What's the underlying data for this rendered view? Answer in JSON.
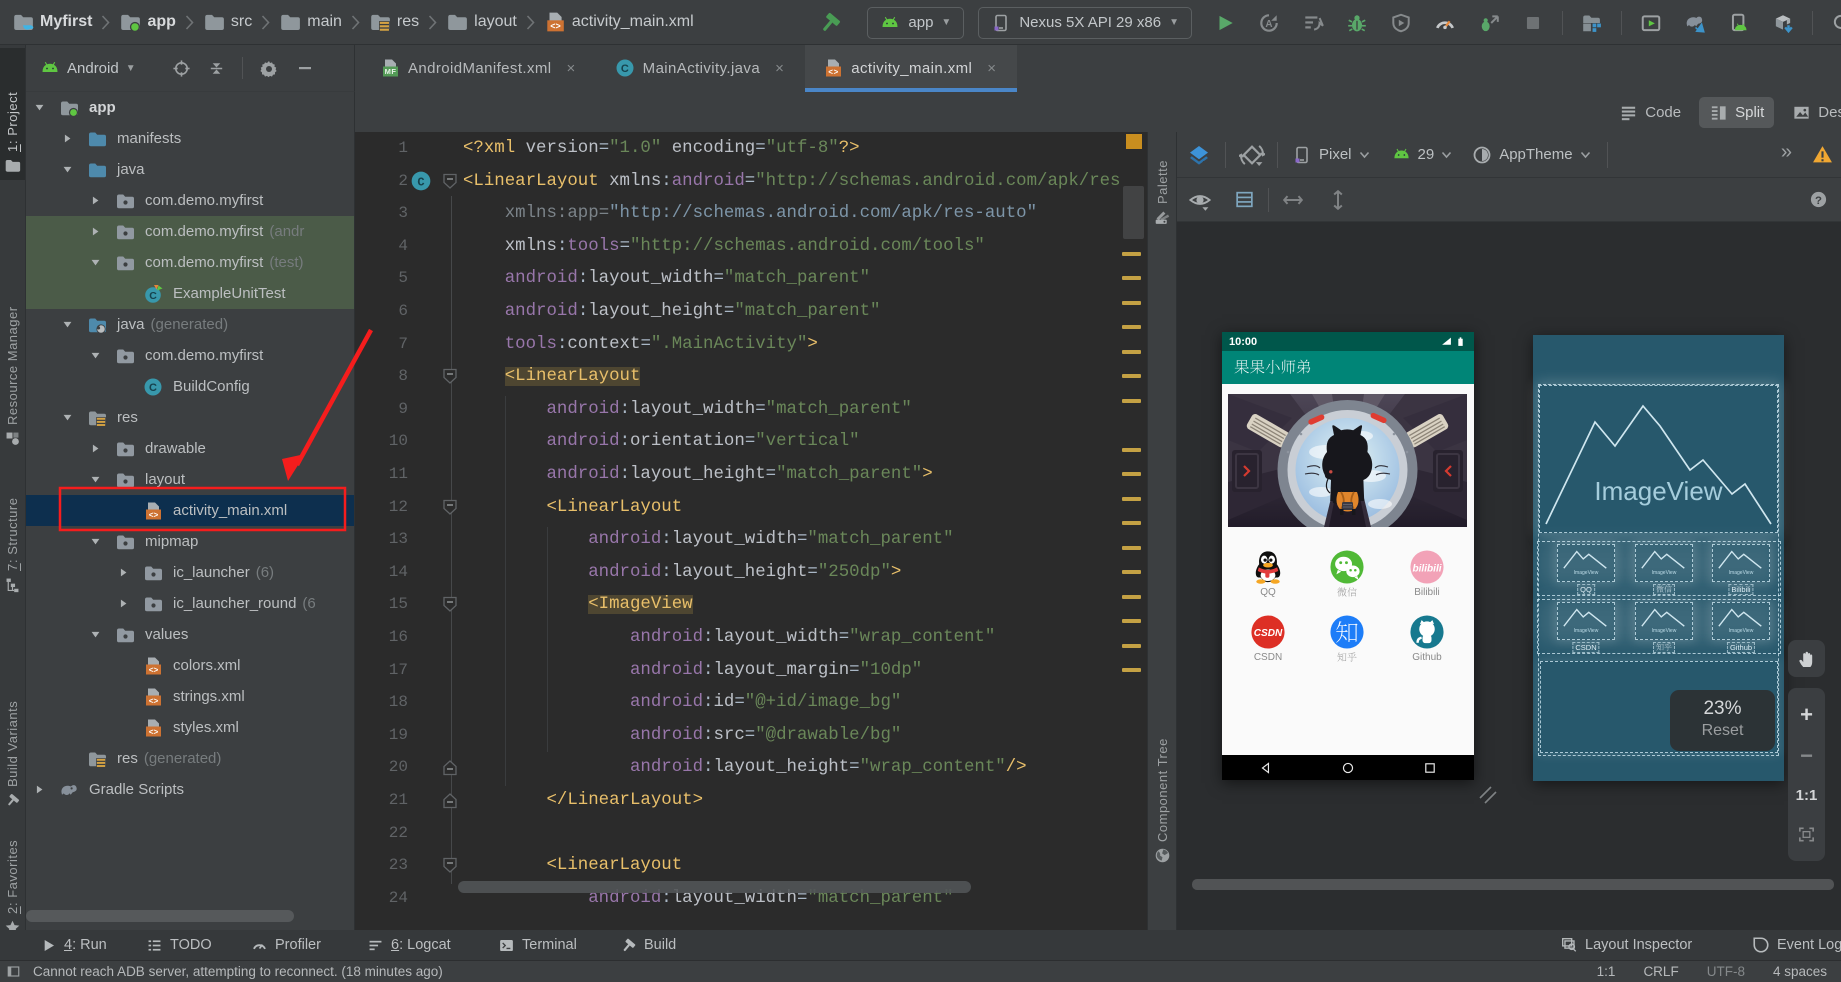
{
  "window_title": "Myfirst",
  "colors": {
    "chrome": "#3c3f41",
    "editor_bg": "#2b2b2b",
    "accent_blue": "#4a86c8",
    "selection_row": "#0d2f4e",
    "test_row": "#4b5b48",
    "tag_gold": "#e8bf6a",
    "value_green": "#6a8759",
    "ns_purple": "#9876aa",
    "appbar_teal": "#008577",
    "statusbar_teal": "#00574b",
    "blueprint_teal": "#27586c",
    "annotation_red": "#f22613"
  },
  "titlebar": {
    "breadcrumbs": [
      {
        "label": "Myfirst",
        "icon": "folder-project-icon",
        "bold": true
      },
      {
        "label": "app",
        "icon": "folder-module-icon",
        "bold": true
      },
      {
        "label": "src",
        "icon": "folder-icon",
        "bold": false
      },
      {
        "label": "main",
        "icon": "folder-icon",
        "bold": false
      },
      {
        "label": "res",
        "icon": "folder-res-icon",
        "bold": false
      },
      {
        "label": "layout",
        "icon": "folder-icon",
        "bold": false
      },
      {
        "label": "activity_main.xml",
        "icon": "file-xml-icon",
        "bold": false
      }
    ],
    "run_config": {
      "label": "app",
      "icon": "android-head-icon"
    },
    "device_selector": {
      "label": "Nexus 5X API 29 x86",
      "icon": "phone-icon"
    },
    "actions": [
      "hammer",
      "combo-app",
      "combo-device",
      "run",
      "apply-changes",
      "apply-code",
      "debug",
      "coverage",
      "profiler",
      "attach-debugger",
      "stop",
      "sep",
      "project-structure",
      "sep",
      "run-window",
      "gradle-sync",
      "device-manager",
      "sdk-manager",
      "sep",
      "search"
    ]
  },
  "project_header": {
    "selector": "Android",
    "tools": [
      "locate",
      "collapse-all",
      "sep",
      "settings",
      "hide"
    ]
  },
  "editor_tabs": [
    {
      "label": "AndroidManifest.xml",
      "icon": "file-manifest-icon",
      "active": false
    },
    {
      "label": "MainActivity.java",
      "icon": "class-icon",
      "active": false
    },
    {
      "label": "activity_main.xml",
      "icon": "file-xml-icon",
      "active": true
    }
  ],
  "project_tree": [
    {
      "label": "app",
      "icon": "folder-module-icon",
      "chevron": "down",
      "indent": 0,
      "bold": true,
      "bg": ""
    },
    {
      "label": "manifests",
      "icon": "folder-blue-icon",
      "chevron": "right",
      "indent": 1,
      "bg": ""
    },
    {
      "label": "java",
      "icon": "folder-blue-icon",
      "chevron": "down",
      "indent": 1,
      "bg": ""
    },
    {
      "label": "com.demo.myfirst",
      "icon": "package-icon",
      "chevron": "right",
      "indent": 2,
      "bg": ""
    },
    {
      "label": "com.demo.myfirst",
      "suffix": "(andr",
      "icon": "package-icon",
      "chevron": "right",
      "indent": 2,
      "bg": "test"
    },
    {
      "label": "com.demo.myfirst",
      "suffix": "(test)",
      "icon": "package-icon",
      "chevron": "down",
      "indent": 2,
      "bg": "test"
    },
    {
      "label": "ExampleUnitTest",
      "icon": "class-run-icon",
      "chevron": "none",
      "indent": 3,
      "bg": "test"
    },
    {
      "label": "java",
      "suffix": "(generated)",
      "icon": "folder-gen-icon",
      "chevron": "down",
      "indent": 1,
      "bg": ""
    },
    {
      "label": "com.demo.myfirst",
      "icon": "package-icon",
      "chevron": "down",
      "indent": 2,
      "bg": ""
    },
    {
      "label": "BuildConfig",
      "icon": "class-icon",
      "chevron": "none",
      "indent": 3,
      "bg": ""
    },
    {
      "label": "res",
      "icon": "folder-res-icon",
      "chevron": "down",
      "indent": 1,
      "bg": ""
    },
    {
      "label": "drawable",
      "icon": "folder-gray-icon",
      "chevron": "right",
      "indent": 2,
      "bg": ""
    },
    {
      "label": "layout",
      "icon": "folder-gray-icon",
      "chevron": "down",
      "indent": 2,
      "bg": ""
    },
    {
      "label": "activity_main.xml",
      "icon": "file-xml-icon",
      "chevron": "none",
      "indent": 3,
      "bg": "sel"
    },
    {
      "label": "mipmap",
      "icon": "folder-gray-icon",
      "chevron": "down",
      "indent": 2,
      "bg": ""
    },
    {
      "label": "ic_launcher",
      "suffix": "(6)",
      "icon": "folder-gray-icon",
      "chevron": "right",
      "indent": 3,
      "bg": ""
    },
    {
      "label": "ic_launcher_round",
      "suffix": "(6",
      "icon": "folder-gray-icon",
      "chevron": "right",
      "indent": 3,
      "bg": ""
    },
    {
      "label": "values",
      "icon": "folder-gray-icon",
      "chevron": "down",
      "indent": 2,
      "bg": ""
    },
    {
      "label": "colors.xml",
      "icon": "file-xml-icon",
      "chevron": "none",
      "indent": 3,
      "bg": ""
    },
    {
      "label": "strings.xml",
      "icon": "file-xml-icon",
      "chevron": "none",
      "indent": 3,
      "bg": ""
    },
    {
      "label": "styles.xml",
      "icon": "file-xml-icon",
      "chevron": "none",
      "indent": 3,
      "bg": ""
    },
    {
      "label": "res",
      "suffix": "(generated)",
      "icon": "folder-res-icon",
      "chevron": "none",
      "indent": 1,
      "bg": ""
    },
    {
      "label": "Gradle Scripts",
      "icon": "gradle-icon",
      "chevron": "right",
      "indent": 0,
      "bg": ""
    }
  ],
  "code": {
    "lines": [
      {
        "n": 1,
        "toks": [
          [
            "t",
            "<?xml "
          ],
          [
            "a",
            "version"
          ],
          [
            "p",
            "="
          ],
          [
            "v",
            "\"1.0\""
          ],
          [
            "p",
            " "
          ],
          [
            "a",
            "encoding"
          ],
          [
            "p",
            "="
          ],
          [
            "v",
            "\"utf-8\""
          ],
          [
            "t",
            "?>"
          ]
        ]
      },
      {
        "n": 2,
        "gutter": [
          "class",
          "fold-open"
        ],
        "toks": [
          [
            "t",
            "<LinearLayout "
          ],
          [
            "a",
            "xmlns"
          ],
          [
            "p",
            ":"
          ],
          [
            "s",
            "android"
          ],
          [
            "p",
            "="
          ],
          [
            "v",
            "\"http://schemas.android.com/apk/res/android\""
          ]
        ]
      },
      {
        "n": 3,
        "toks": [
          [
            "p",
            "    "
          ],
          [
            "d",
            "xmlns:app"
          ],
          [
            "d",
            "="
          ],
          [
            "dv",
            "\"http://schemas.android.com/apk/res-auto\""
          ]
        ]
      },
      {
        "n": 4,
        "toks": [
          [
            "p",
            "    "
          ],
          [
            "a",
            "xmlns"
          ],
          [
            "p",
            ":"
          ],
          [
            "s",
            "tools"
          ],
          [
            "p",
            "="
          ],
          [
            "v",
            "\"http://schemas.android.com/tools\""
          ]
        ]
      },
      {
        "n": 5,
        "toks": [
          [
            "p",
            "    "
          ],
          [
            "s",
            "android"
          ],
          [
            "p",
            ":"
          ],
          [
            "a",
            "layout_width"
          ],
          [
            "p",
            "="
          ],
          [
            "v",
            "\"match_parent\""
          ]
        ]
      },
      {
        "n": 6,
        "toks": [
          [
            "p",
            "    "
          ],
          [
            "s",
            "android"
          ],
          [
            "p",
            ":"
          ],
          [
            "a",
            "layout_height"
          ],
          [
            "p",
            "="
          ],
          [
            "v",
            "\"match_parent\""
          ]
        ]
      },
      {
        "n": 7,
        "toks": [
          [
            "p",
            "    "
          ],
          [
            "s",
            "tools"
          ],
          [
            "p",
            ":"
          ],
          [
            "a",
            "context"
          ],
          [
            "p",
            "="
          ],
          [
            "v",
            "\".MainActivity\""
          ],
          [
            "t",
            ">"
          ]
        ]
      },
      {
        "n": 8,
        "gutter": [
          "fold-open"
        ],
        "toks": [
          [
            "p",
            "    "
          ],
          [
            "th",
            "<LinearLayout"
          ]
        ]
      },
      {
        "n": 9,
        "toks": [
          [
            "p",
            "        "
          ],
          [
            "s",
            "android"
          ],
          [
            "p",
            ":"
          ],
          [
            "a",
            "layout_width"
          ],
          [
            "p",
            "="
          ],
          [
            "v",
            "\"match_parent\""
          ]
        ]
      },
      {
        "n": 10,
        "toks": [
          [
            "p",
            "        "
          ],
          [
            "s",
            "android"
          ],
          [
            "p",
            ":"
          ],
          [
            "a",
            "orientation"
          ],
          [
            "p",
            "="
          ],
          [
            "v",
            "\"vertical\""
          ]
        ]
      },
      {
        "n": 11,
        "toks": [
          [
            "p",
            "        "
          ],
          [
            "s",
            "android"
          ],
          [
            "p",
            ":"
          ],
          [
            "a",
            "layout_height"
          ],
          [
            "p",
            "="
          ],
          [
            "v",
            "\"match_parent\""
          ],
          [
            "t",
            ">"
          ]
        ]
      },
      {
        "n": 12,
        "gutter": [
          "fold-open"
        ],
        "toks": [
          [
            "p",
            "        "
          ],
          [
            "t",
            "<LinearLayout"
          ]
        ]
      },
      {
        "n": 13,
        "toks": [
          [
            "p",
            "            "
          ],
          [
            "s",
            "android"
          ],
          [
            "p",
            ":"
          ],
          [
            "a",
            "layout_width"
          ],
          [
            "p",
            "="
          ],
          [
            "v",
            "\"match_parent\""
          ]
        ]
      },
      {
        "n": 14,
        "toks": [
          [
            "p",
            "            "
          ],
          [
            "s",
            "android"
          ],
          [
            "p",
            ":"
          ],
          [
            "a",
            "layout_height"
          ],
          [
            "p",
            "="
          ],
          [
            "v",
            "\"250dp\""
          ],
          [
            "t",
            ">"
          ]
        ]
      },
      {
        "n": 15,
        "gutter": [
          "fold-open"
        ],
        "toks": [
          [
            "p",
            "            "
          ],
          [
            "th",
            "<ImageView"
          ]
        ]
      },
      {
        "n": 16,
        "toks": [
          [
            "p",
            "                "
          ],
          [
            "s",
            "android"
          ],
          [
            "p",
            ":"
          ],
          [
            "a",
            "layout_width"
          ],
          [
            "p",
            "="
          ],
          [
            "v",
            "\"wrap_content\""
          ]
        ]
      },
      {
        "n": 17,
        "toks": [
          [
            "p",
            "                "
          ],
          [
            "s",
            "android"
          ],
          [
            "p",
            ":"
          ],
          [
            "a",
            "layout_margin"
          ],
          [
            "p",
            "="
          ],
          [
            "v",
            "\"10dp\""
          ]
        ]
      },
      {
        "n": 18,
        "toks": [
          [
            "p",
            "                "
          ],
          [
            "s",
            "android"
          ],
          [
            "p",
            ":"
          ],
          [
            "a",
            "id"
          ],
          [
            "p",
            "="
          ],
          [
            "v",
            "\"@+id/image_bg\""
          ]
        ]
      },
      {
        "n": 19,
        "toks": [
          [
            "p",
            "                "
          ],
          [
            "s",
            "android"
          ],
          [
            "p",
            ":"
          ],
          [
            "a",
            "src"
          ],
          [
            "p",
            "="
          ],
          [
            "v",
            "\"@drawable/bg\""
          ]
        ]
      },
      {
        "n": 20,
        "gutter": [
          "fold-close"
        ],
        "toks": [
          [
            "p",
            "                "
          ],
          [
            "s",
            "android"
          ],
          [
            "p",
            ":"
          ],
          [
            "a",
            "layout_height"
          ],
          [
            "p",
            "="
          ],
          [
            "v",
            "\"wrap_content\""
          ],
          [
            "t",
            "/>"
          ]
        ]
      },
      {
        "n": 21,
        "gutter": [
          "fold-close"
        ],
        "toks": [
          [
            "p",
            "        "
          ],
          [
            "t",
            "</LinearLayout>"
          ]
        ]
      },
      {
        "n": 22,
        "toks": []
      },
      {
        "n": 23,
        "gutter": [
          "fold-open"
        ],
        "toks": [
          [
            "p",
            "        "
          ],
          [
            "t",
            "<LinearLayout"
          ]
        ]
      },
      {
        "n": 24,
        "toks": [
          [
            "p",
            "            "
          ],
          [
            "s",
            "android"
          ],
          [
            "p",
            ":"
          ],
          [
            "a",
            "layout_width"
          ],
          [
            "p",
            "="
          ],
          [
            "v",
            "\"match_parent\""
          ]
        ]
      }
    ],
    "stripe_marks": [
      120,
      144,
      169,
      193,
      218,
      242,
      267,
      316,
      340,
      365,
      389,
      414,
      438,
      463,
      487,
      512,
      536
    ]
  },
  "right_strip": [
    {
      "label": "Palette",
      "icon": "palette-icon"
    },
    {
      "label": "Component Tree",
      "icon": "globe-icon"
    }
  ],
  "left_strip": [
    {
      "label": "1: Project",
      "icon": "tw-project-icon",
      "active": true,
      "mnemonic": "1"
    },
    {
      "label": "Resource Manager",
      "icon": "tw-resource-icon"
    },
    {
      "label": "7: Structure",
      "icon": "tw-structure-icon",
      "mnemonic": "7"
    },
    {
      "label": "Build Variants",
      "icon": "tw-variants-icon"
    },
    {
      "label": "2: Favorites",
      "icon": "tw-star-icon",
      "mnemonic": "2"
    }
  ],
  "design": {
    "modes": [
      {
        "label": "Code",
        "icon": "mode-code-icon",
        "active": false
      },
      {
        "label": "Split",
        "icon": "mode-split-icon",
        "active": true
      },
      {
        "label": "Design",
        "icon": "mode-design-icon",
        "active": false
      }
    ],
    "toolbar": {
      "device": "Pixel",
      "api": "29",
      "theme": "AppTheme"
    },
    "phone": {
      "time": "10:00",
      "app_title": "果果小师弟",
      "apps": [
        {
          "label": "QQ",
          "icon": "qq-icon"
        },
        {
          "label": "微信",
          "icon": "wechat-icon"
        },
        {
          "label": "Bilibili",
          "icon": "bilibili-icon"
        },
        {
          "label": "CSDN",
          "icon": "csdn-icon"
        },
        {
          "label": "知乎",
          "icon": "zhihu-icon"
        },
        {
          "label": "Github",
          "icon": "github-icon"
        }
      ]
    },
    "blueprint": {
      "main_label": "ImageView",
      "mini_label": "ImageView",
      "cell_labels": [
        "QQ",
        "微信",
        "Bilibili",
        "CSDN",
        "知乎",
        "Github"
      ]
    },
    "zoom_overlay": {
      "percent": "23%",
      "reset": "Reset"
    },
    "zoom_controls": {
      "one_one": "1:1"
    }
  },
  "bottom_bar": {
    "left": [
      {
        "label": "4: Run",
        "icon": "play-gray-icon",
        "mnemonic": "4"
      },
      {
        "label": "TODO",
        "icon": "todo-icon"
      },
      {
        "label": "Profiler",
        "icon": "gauge-icon"
      },
      {
        "label": "6: Logcat",
        "icon": "logcat-icon",
        "mnemonic": "6"
      },
      {
        "label": "Terminal",
        "icon": "terminal-icon"
      },
      {
        "label": "Build",
        "icon": "hammer-gray-icon"
      }
    ],
    "right": [
      {
        "label": "Layout Inspector",
        "icon": "layout-inspector-icon"
      },
      {
        "label": "Event Log",
        "icon": "event-log-icon"
      }
    ]
  },
  "status_bar": {
    "message": "Cannot reach ADB server, attempting to reconnect. (18 minutes ago)",
    "caret": "1:1",
    "line_ending": "CRLF",
    "encoding": "UTF-8",
    "indent": "4 spaces"
  }
}
